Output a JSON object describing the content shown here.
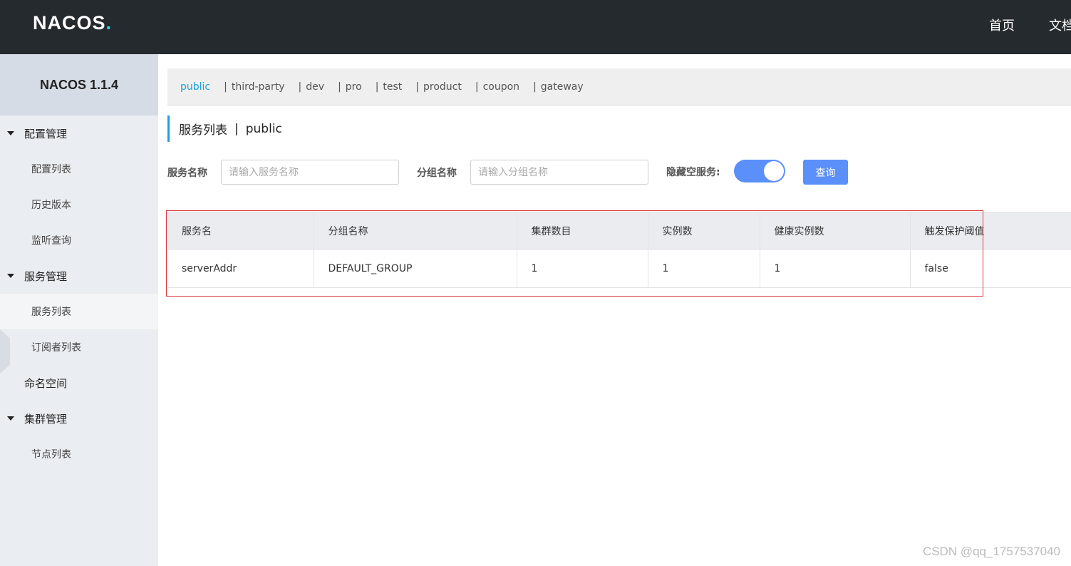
{
  "header": {
    "logo_text": "NACOS",
    "logo_dot": ".",
    "nav": [
      "首页",
      "文档"
    ]
  },
  "sidebar": {
    "title": "NACOS 1.1.4",
    "groups": [
      {
        "label": "配置管理",
        "items": [
          "配置列表",
          "历史版本",
          "监听查询"
        ]
      },
      {
        "label": "服务管理",
        "items": [
          "服务列表",
          "订阅者列表"
        ]
      },
      {
        "label": "命名空间"
      },
      {
        "label": "集群管理",
        "items": [
          "节点列表"
        ]
      }
    ],
    "active_item": "服务列表"
  },
  "namespaces": [
    "public",
    "third-party",
    "dev",
    "pro",
    "test",
    "product",
    "coupon",
    "gateway"
  ],
  "namespace_separator": "|",
  "page_title": {
    "main": "服务列表",
    "separator": "|",
    "namespace": "public"
  },
  "filters": {
    "service_name_label": "服务名称",
    "service_name_placeholder": "请输入服务名称",
    "group_name_label": "分组名称",
    "group_name_placeholder": "请输入分组名称",
    "hide_empty_label": "隐藏空服务:",
    "hide_empty_on": true,
    "query_label": "查询"
  },
  "table": {
    "headers": [
      "服务名",
      "分组名称",
      "集群数目",
      "实例数",
      "健康实例数",
      "触发保护阈值"
    ],
    "rows": [
      [
        "serverAddr",
        "DEFAULT_GROUP",
        "1",
        "1",
        "1",
        "false"
      ]
    ]
  },
  "watermark": "CSDN @qq_1757537040",
  "colors": {
    "header_bg": "#252a2f",
    "accent": "#1ca0e2",
    "button": "#5b8ff9",
    "highlight_border": "#d9363e"
  }
}
